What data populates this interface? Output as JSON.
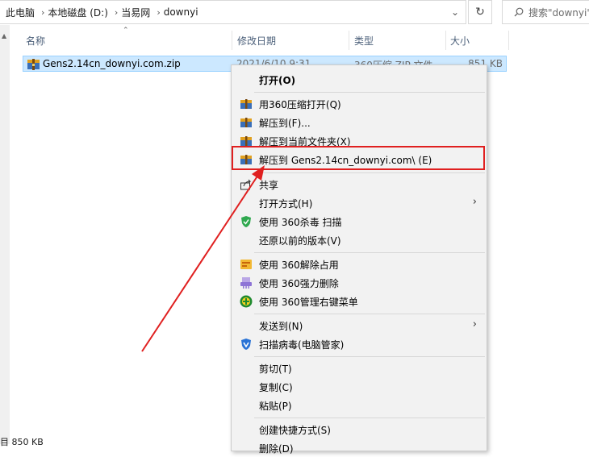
{
  "address": {
    "crumbs": [
      "此电脑",
      "本地磁盘 (D:)",
      "当易网",
      "downyi"
    ],
    "search_placeholder": "搜索\"downyi\""
  },
  "columns": {
    "name": "名称",
    "date": "修改日期",
    "type": "类型",
    "size": "大小"
  },
  "file": {
    "name": "Gens2.14cn_downyi.com.zip",
    "date": "2021/6/10 9:31",
    "type": "360压缩 ZIP 文件",
    "size": "851 KB"
  },
  "status_bar": {
    "text": "目  850 KB"
  },
  "menu": {
    "open": "打开(O)",
    "open_360": "用360压缩打开(Q)",
    "extract_to": "解压到(F)...",
    "extract_here": "解压到当前文件夹(X)",
    "extract_named": "解压到 Gens2.14cn_downyi.com\\ (E)",
    "share": "共享",
    "open_with": "打开方式(H)",
    "scan_360": "使用 360杀毒 扫描",
    "restore": "还原以前的版本(V)",
    "unlock_360": "使用 360解除占用",
    "force_delete": "使用 360强力删除",
    "manage_menu": "使用 360管理右键菜单",
    "send_to": "发送到(N)",
    "scan_virus": "扫描病毒(电脑管家)",
    "cut": "剪切(T)",
    "copy": "复制(C)",
    "paste": "粘贴(P)",
    "create_shortcut": "创建快捷方式(S)",
    "delete": "删除(D)"
  },
  "colors": {
    "highlight": "#e02020",
    "selection": "#cce8ff",
    "menu_bg": "#f2f2f2"
  }
}
